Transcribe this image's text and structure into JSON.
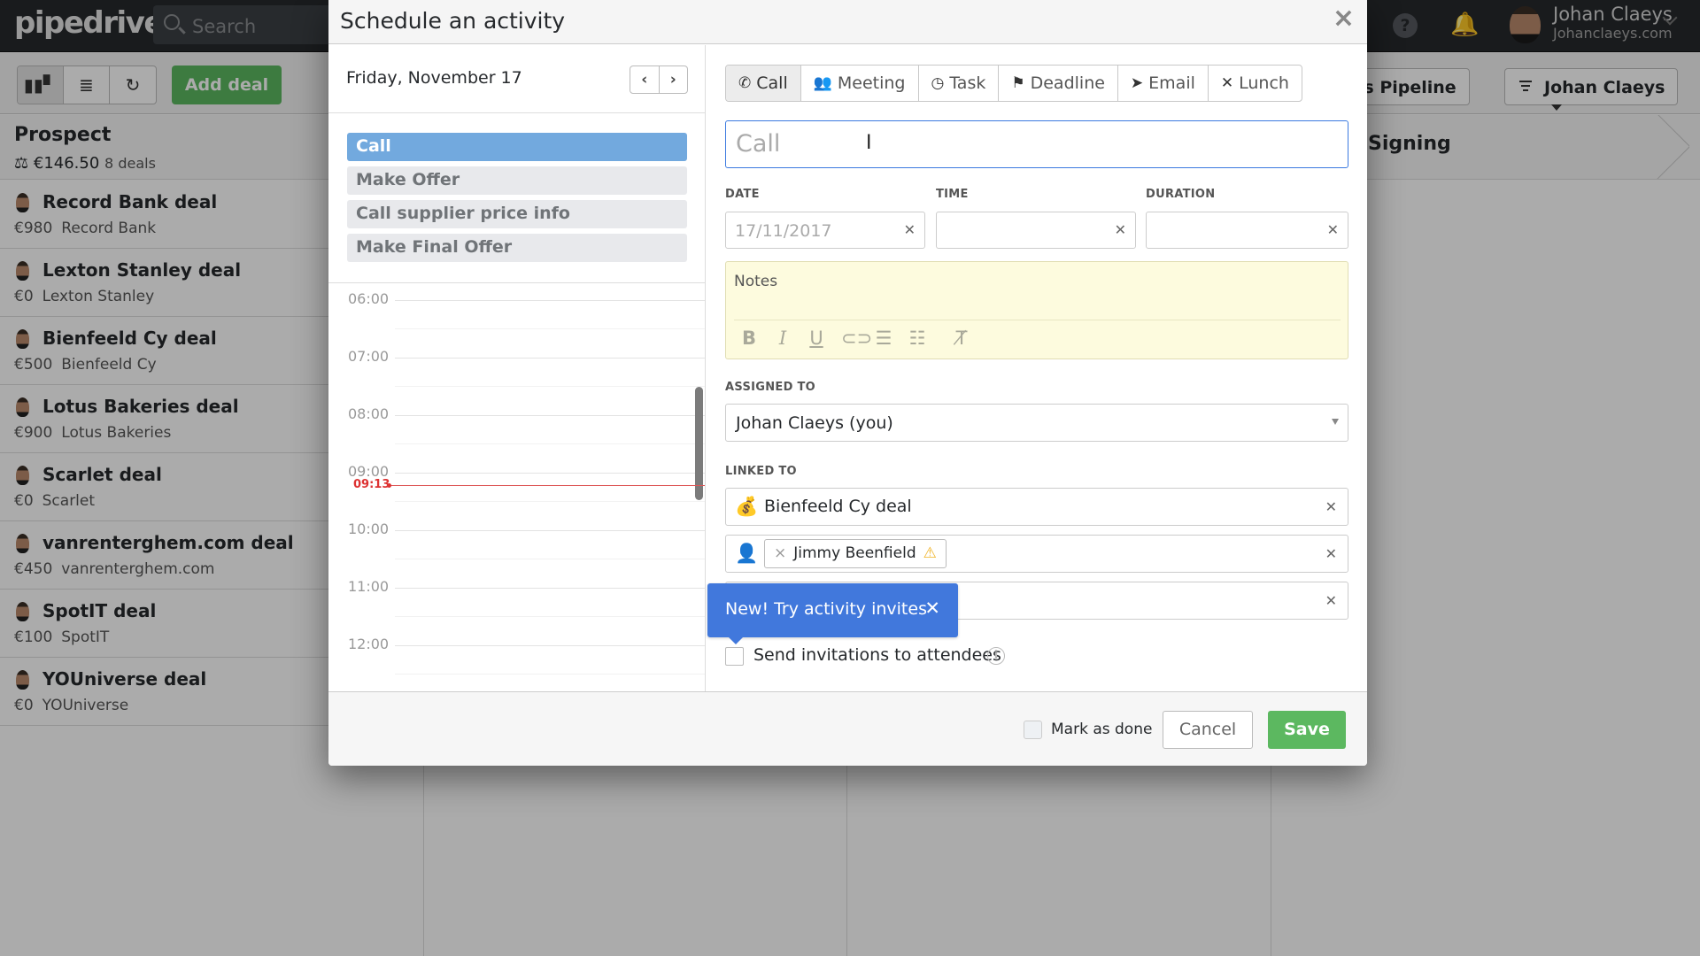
{
  "app": {
    "logo": "pipedrive",
    "search_placeholder": "Search",
    "user_name": "Johan Claeys",
    "user_company": "Johanclaeys.com",
    "brand_green": "#5cb860"
  },
  "toolbar": {
    "view_icons": [
      "pipeline-view-icon",
      "list-view-icon",
      "forecast-view-icon"
    ],
    "add_deal_label": "Add deal",
    "pipeline_label": "les Pipeline",
    "owner_label": "Johan Claeys"
  },
  "stages": {
    "prospect": {
      "name": "Prospect",
      "total": "€146.50",
      "count": "8 deals"
    },
    "signing": {
      "name": "Signing"
    }
  },
  "deals": [
    {
      "title": "Record Bank deal",
      "value": "€980",
      "org": "Record Bank"
    },
    {
      "title": "Lexton Stanley deal",
      "value": "€0",
      "org": "Lexton Stanley"
    },
    {
      "title": "Bienfeeld Cy deal",
      "value": "€500",
      "org": "Bienfeeld Cy"
    },
    {
      "title": "Lotus Bakeries deal",
      "value": "€900",
      "org": "Lotus Bakeries"
    },
    {
      "title": "Scarlet deal",
      "value": "€0",
      "org": "Scarlet"
    },
    {
      "title": "vanrenterghem.com deal",
      "value": "€450",
      "org": "vanrenterghem.com"
    },
    {
      "title": "SpotIT deal",
      "value": "€100",
      "org": "SpotIT"
    },
    {
      "title": "YOUniverse deal",
      "value": "€0",
      "org": "YOUniverse"
    }
  ],
  "modal": {
    "title": "Schedule an activity",
    "close": "×",
    "day_label": "Friday, November 17",
    "prev": "‹",
    "next": "›",
    "activity_types": [
      "Call",
      "Make Offer",
      "Call supplier price info",
      "Make Final Offer"
    ],
    "active_type_index": 0,
    "timeline": {
      "hours": [
        "06:00",
        "07:00",
        "08:00",
        "09:00",
        "10:00",
        "11:00",
        "12:00"
      ],
      "now": "09:13"
    },
    "tabs": [
      {
        "label": "Call",
        "icon": "✆"
      },
      {
        "label": "Meeting",
        "icon": "👥"
      },
      {
        "label": "Task",
        "icon": "◷"
      },
      {
        "label": "Deadline",
        "icon": "⚑"
      },
      {
        "label": "Email",
        "icon": "➤"
      },
      {
        "label": "Lunch",
        "icon": "✕"
      }
    ],
    "active_tab": "Call",
    "subject_placeholder": "Call",
    "date_label": "DATE",
    "date_value": "17/11/2017",
    "time_label": "TIME",
    "time_value": "",
    "duration_label": "DURATION",
    "duration_value": "",
    "notes_placeholder": "Notes",
    "assigned_label": "ASSIGNED TO",
    "assigned_value": "Johan Claeys (you)",
    "linked_label": "LINKED TO",
    "linked_deal": "Bienfeeld Cy deal",
    "linked_person": "Jimmy Beenfield",
    "linked_org": "",
    "invite_label": "Send invitations to attendees",
    "tooltip_text": "New! Try activity invites",
    "mark_done_label": "Mark as done",
    "cancel_label": "Cancel",
    "save_label": "Save"
  }
}
